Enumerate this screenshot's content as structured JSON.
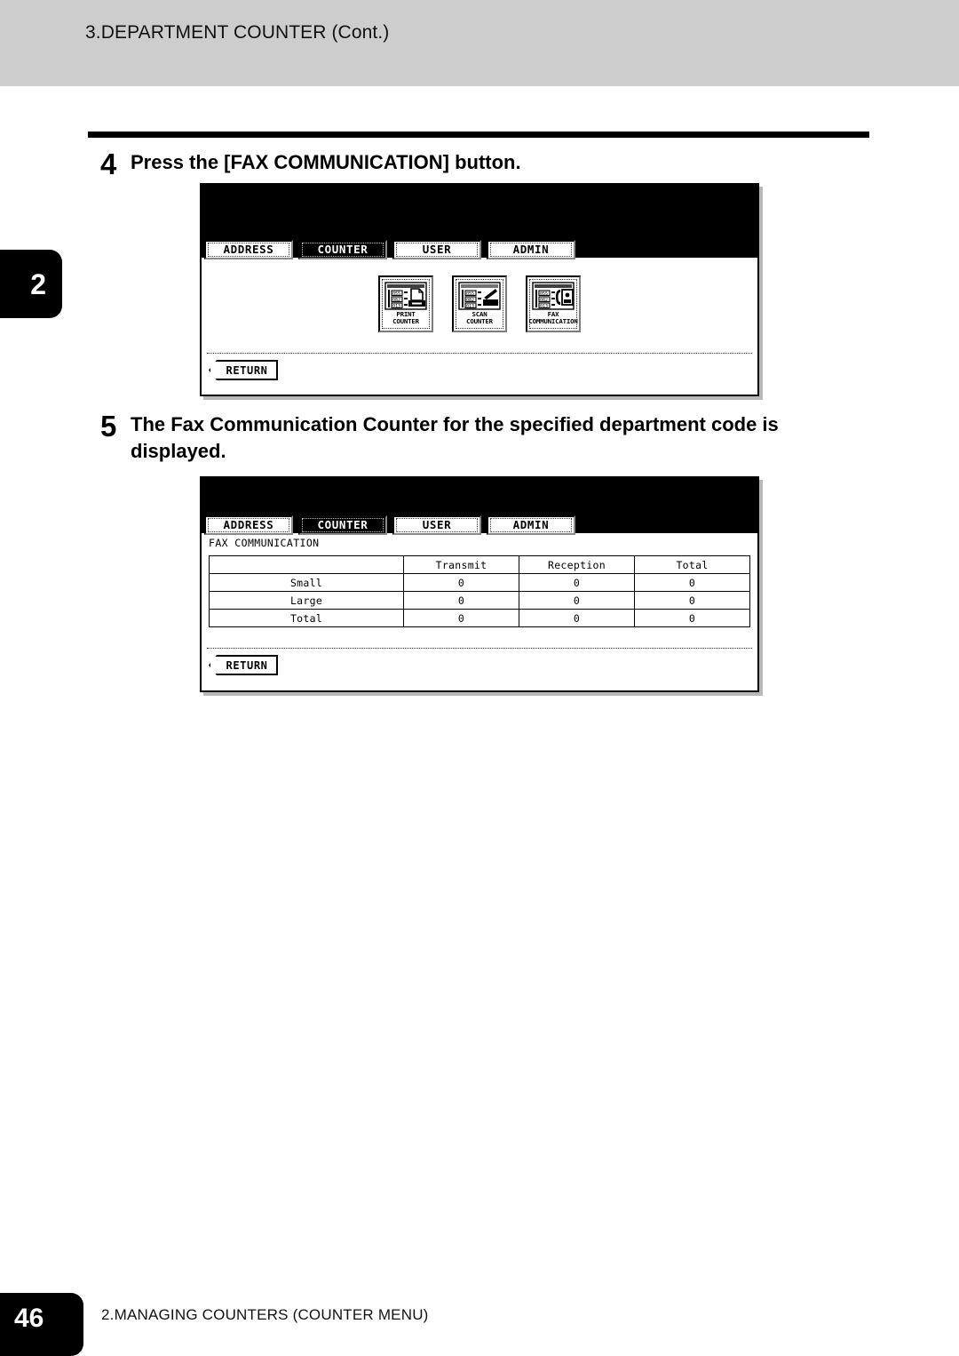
{
  "header": {
    "title": "3.DEPARTMENT COUNTER (Cont.)"
  },
  "chapter_tab": {
    "number": "2"
  },
  "steps": [
    {
      "number": "4",
      "text": "Press the [FAX COMMUNICATION] button."
    },
    {
      "number": "5",
      "text": "The Fax Communication Counter for the specified department code is displayed."
    }
  ],
  "panel_top": {
    "tabs": [
      {
        "label": "ADDRESS",
        "selected": false
      },
      {
        "label": "COUNTER",
        "selected": true
      },
      {
        "label": "USER",
        "selected": false
      },
      {
        "label": "ADMIN",
        "selected": false
      }
    ],
    "icon_buttons": [
      {
        "icon": "print-counter-icon",
        "caption": "PRINT\nCOUNTER"
      },
      {
        "icon": "scan-counter-icon",
        "caption": "SCAN\nCOUNTER"
      },
      {
        "icon": "fax-communication-icon",
        "caption": "FAX\nCOMMUNICATION"
      }
    ],
    "icon_list_values": [
      "055",
      "082",
      "013"
    ],
    "return_label": "RETURN"
  },
  "panel_bottom": {
    "tabs": [
      {
        "label": "ADDRESS",
        "selected": false
      },
      {
        "label": "COUNTER",
        "selected": true
      },
      {
        "label": "USER",
        "selected": false
      },
      {
        "label": "ADMIN",
        "selected": false
      }
    ],
    "screen_title": "FAX COMMUNICATION",
    "table": {
      "columns": [
        "",
        "Transmit",
        "Reception",
        "Total"
      ],
      "rows": [
        {
          "label": "Small",
          "values": [
            "0",
            "0",
            "0"
          ]
        },
        {
          "label": "Large",
          "values": [
            "0",
            "0",
            "0"
          ]
        },
        {
          "label": "Total",
          "values": [
            "0",
            "0",
            "0"
          ]
        }
      ]
    },
    "return_label": "RETURN"
  },
  "footer": {
    "page_number": "46",
    "section": "2.MANAGING COUNTERS (COUNTER MENU)"
  }
}
